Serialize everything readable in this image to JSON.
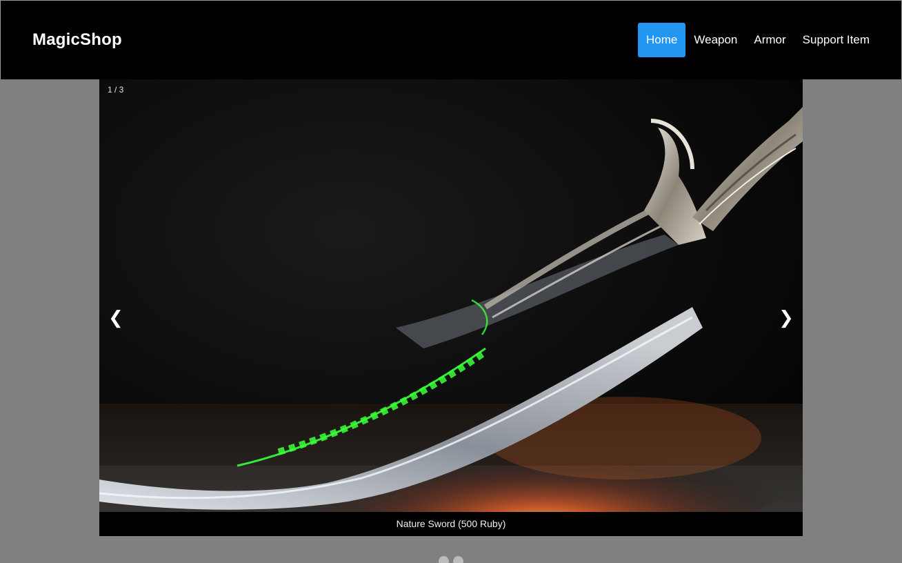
{
  "navbar": {
    "brand": "MagicShop",
    "items": [
      {
        "label": "Home",
        "active": true
      },
      {
        "label": "Weapon",
        "active": false
      },
      {
        "label": "Armor",
        "active": false
      },
      {
        "label": "Support Item",
        "active": false
      }
    ]
  },
  "slideshow": {
    "number_text": "1 / 3",
    "prev_symbol": "❮",
    "next_symbol": "❯",
    "caption": "Nature Sword (500 Ruby)",
    "dot_count": 2
  },
  "colors": {
    "page_background": "#808080",
    "navbar_background": "#000000",
    "active_nav": "#2196f3",
    "rune_glow": "#39ff3a"
  }
}
